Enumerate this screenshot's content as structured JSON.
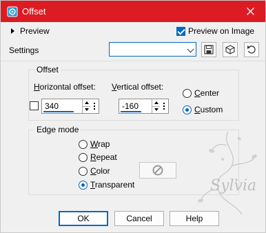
{
  "window": {
    "title": "Offset",
    "accent_color": "#dd1b22"
  },
  "preview": {
    "label": "Preview",
    "preview_on_image_label": "Preview on Image",
    "preview_on_image_checked": true
  },
  "settings": {
    "label": "Settings",
    "combo_value": ""
  },
  "offset": {
    "group_label": "Offset",
    "horizontal_label_prefix": "H",
    "horizontal_label_rest": "orizontal offset:",
    "horizontal_value": "340",
    "vertical_label_prefix": "V",
    "vertical_label_rest": "ertical offset:",
    "vertical_value": "-160",
    "link_checked": false,
    "center_prefix": "C",
    "center_rest": "enter",
    "custom_prefix": "C",
    "custom_rest": "ustom",
    "selected": "custom"
  },
  "edge_mode": {
    "group_label": "Edge mode",
    "options": [
      {
        "prefix": "W",
        "rest": "rap"
      },
      {
        "prefix": "R",
        "rest": "epeat"
      },
      {
        "prefix": "C",
        "rest": "olor"
      },
      {
        "prefix": "T",
        "rest": "ransparent"
      }
    ],
    "selected": "Transparent"
  },
  "watermark_text": "Sylvia",
  "buttons": {
    "ok": "OK",
    "cancel": "Cancel",
    "help": "Help"
  }
}
